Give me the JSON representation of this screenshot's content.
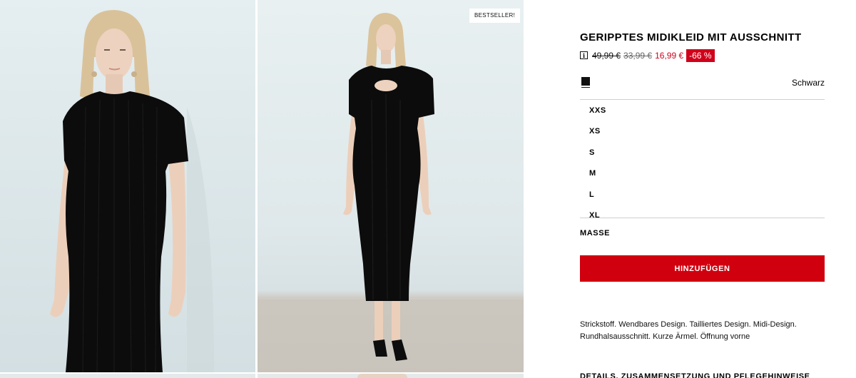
{
  "gallery": {
    "badge": "BESTSELLER!"
  },
  "product": {
    "title": "GERIPPTES MIDIKLEID MIT AUSSCHNITT",
    "price_original": "49,99 €",
    "price_previous": "33,99 €",
    "price_current": "16,99 €",
    "discount": "-66 %",
    "color_name": "Schwarz",
    "color_hex": "#111111",
    "sizes": [
      "XXS",
      "XS",
      "S",
      "M",
      "L",
      "XL"
    ],
    "measure_label": "MASSE",
    "add_button_label": "HINZUFÜGEN",
    "description": "Strickstoff. Wendbares Design. Tailliertes Design. Midi-Design. Rundhalsausschnitt. Kurze Ärmel. Öffnung vorne",
    "details_heading": "DETAILS, ZUSAMMENSETZUNG UND PFLEGEHINWEISE"
  },
  "colors": {
    "accent": "#d0021b",
    "button": "#d0000f"
  }
}
